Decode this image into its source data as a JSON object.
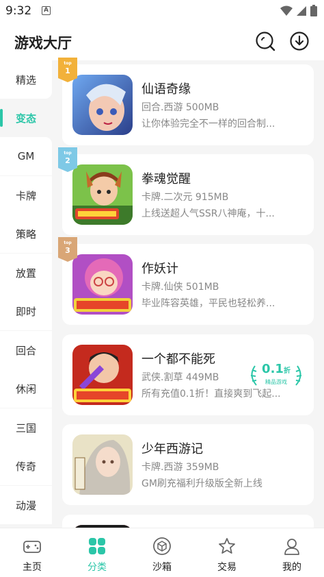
{
  "status_bar": {
    "time": "9:32",
    "notification_letter": "A"
  },
  "header": {
    "title": "游戏大厅",
    "search_icon": "search-icon",
    "download_icon": "download-icon"
  },
  "sidebar": {
    "items": [
      {
        "label": "精选"
      },
      {
        "label": "变态"
      },
      {
        "label": "GM"
      },
      {
        "label": "卡牌"
      },
      {
        "label": "策略"
      },
      {
        "label": "放置"
      },
      {
        "label": "即时"
      },
      {
        "label": "回合"
      },
      {
        "label": "休闲"
      },
      {
        "label": "三国"
      },
      {
        "label": "传奇"
      },
      {
        "label": "动漫"
      }
    ],
    "active_index": 1
  },
  "games": [
    {
      "name": "仙语奇缘",
      "meta": "回合.西游 500MB",
      "desc": "让你体验完全不一样的回合制...",
      "rank_label": "top",
      "rank": "1",
      "badge_color": "#f2b13a"
    },
    {
      "name": "拳魂觉醒",
      "meta": "卡牌.二次元 915MB",
      "desc": "上线送超人气SSR八神庵，十...",
      "rank_label": "top",
      "rank": "2",
      "badge_color": "#7ec9e6"
    },
    {
      "name": "作妖计",
      "meta": "卡牌.仙侠 501MB",
      "desc": "毕业阵容英雄，平民也轻松养...",
      "rank_label": "top",
      "rank": "3",
      "badge_color": "#d9a676"
    },
    {
      "name": "一个都不能死",
      "meta": "武侠.割草 449MB",
      "desc": "所有充值0.1折！直接爽到飞起...",
      "discount": "0.1",
      "discount_unit": "折",
      "discount_sub": "精品游戏"
    },
    {
      "name": "少年西游记",
      "meta": "卡牌.西游 359MB",
      "desc": "GM刷充福利升级版全新上线"
    }
  ],
  "bottom_nav": [
    {
      "label": "主页",
      "icon": "gamepad-icon"
    },
    {
      "label": "分类",
      "icon": "category-icon"
    },
    {
      "label": "沙箱",
      "icon": "cube-icon"
    },
    {
      "label": "交易",
      "icon": "star-icon"
    },
    {
      "label": "我的",
      "icon": "user-icon"
    }
  ],
  "colors": {
    "accent": "#2bc6a8",
    "text": "#222222",
    "muted": "#888888"
  }
}
